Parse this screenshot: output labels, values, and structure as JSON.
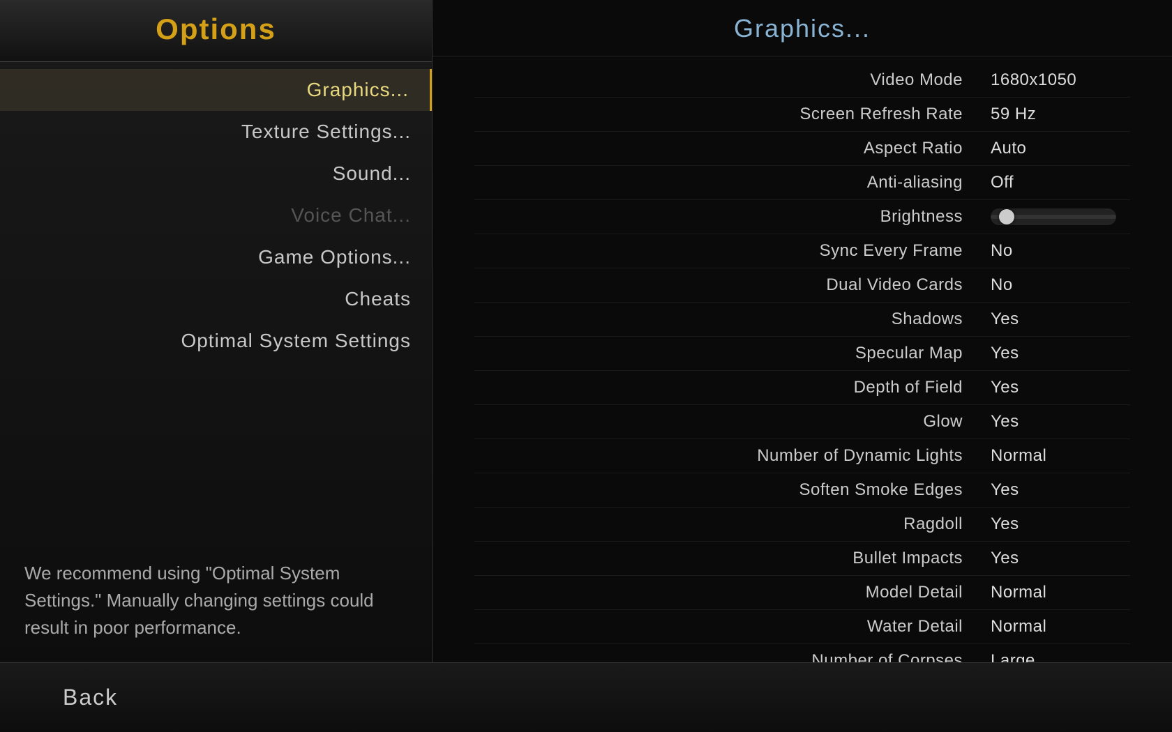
{
  "title": "Options",
  "menu": {
    "items": [
      {
        "id": "graphics",
        "label": "Graphics...",
        "state": "active"
      },
      {
        "id": "texture",
        "label": "Texture Settings...",
        "state": "normal"
      },
      {
        "id": "sound",
        "label": "Sound...",
        "state": "normal"
      },
      {
        "id": "voice-chat",
        "label": "Voice Chat...",
        "state": "disabled"
      },
      {
        "id": "game-options",
        "label": "Game Options...",
        "state": "normal"
      },
      {
        "id": "cheats",
        "label": "Cheats",
        "state": "normal"
      },
      {
        "id": "optimal",
        "label": "Optimal System Settings",
        "state": "normal"
      }
    ]
  },
  "recommendation": "We recommend using \"Optimal System Settings.\"  Manually changing settings could result in poor performance.",
  "graphics": {
    "title": "Graphics...",
    "settings": [
      {
        "id": "video-mode",
        "label": "Video Mode",
        "value": "1680x1050",
        "type": "text"
      },
      {
        "id": "screen-refresh-rate",
        "label": "Screen Refresh Rate",
        "value": "59 Hz",
        "type": "text"
      },
      {
        "id": "aspect-ratio",
        "label": "Aspect Ratio",
        "value": "Auto",
        "type": "text"
      },
      {
        "id": "anti-aliasing",
        "label": "Anti-aliasing",
        "value": "Off",
        "type": "text"
      },
      {
        "id": "brightness",
        "label": "Brightness",
        "value": "",
        "type": "slider"
      },
      {
        "id": "sync-every-frame",
        "label": "Sync Every Frame",
        "value": "No",
        "type": "text"
      },
      {
        "id": "dual-video-cards",
        "label": "Dual Video Cards",
        "value": "No",
        "type": "text"
      },
      {
        "id": "shadows",
        "label": "Shadows",
        "value": "Yes",
        "type": "text"
      },
      {
        "id": "specular-map",
        "label": "Specular Map",
        "value": "Yes",
        "type": "text"
      },
      {
        "id": "depth-of-field",
        "label": "Depth of Field",
        "value": "Yes",
        "type": "text"
      },
      {
        "id": "glow",
        "label": "Glow",
        "value": "Yes",
        "type": "text"
      },
      {
        "id": "number-of-dynamic-lights",
        "label": "Number of Dynamic Lights",
        "value": "Normal",
        "type": "text"
      },
      {
        "id": "soften-smoke-edges",
        "label": "Soften Smoke Edges",
        "value": "Yes",
        "type": "text"
      },
      {
        "id": "ragdoll",
        "label": "Ragdoll",
        "value": "Yes",
        "type": "text"
      },
      {
        "id": "bullet-impacts",
        "label": "Bullet Impacts",
        "value": "Yes",
        "type": "text"
      },
      {
        "id": "model-detail",
        "label": "Model Detail",
        "value": "Normal",
        "type": "text"
      },
      {
        "id": "water-detail",
        "label": "Water Detail",
        "value": "Normal",
        "type": "text"
      },
      {
        "id": "number-of-corpses",
        "label": "Number of Corpses",
        "value": "Large",
        "type": "text"
      }
    ]
  },
  "back_button": "Back"
}
